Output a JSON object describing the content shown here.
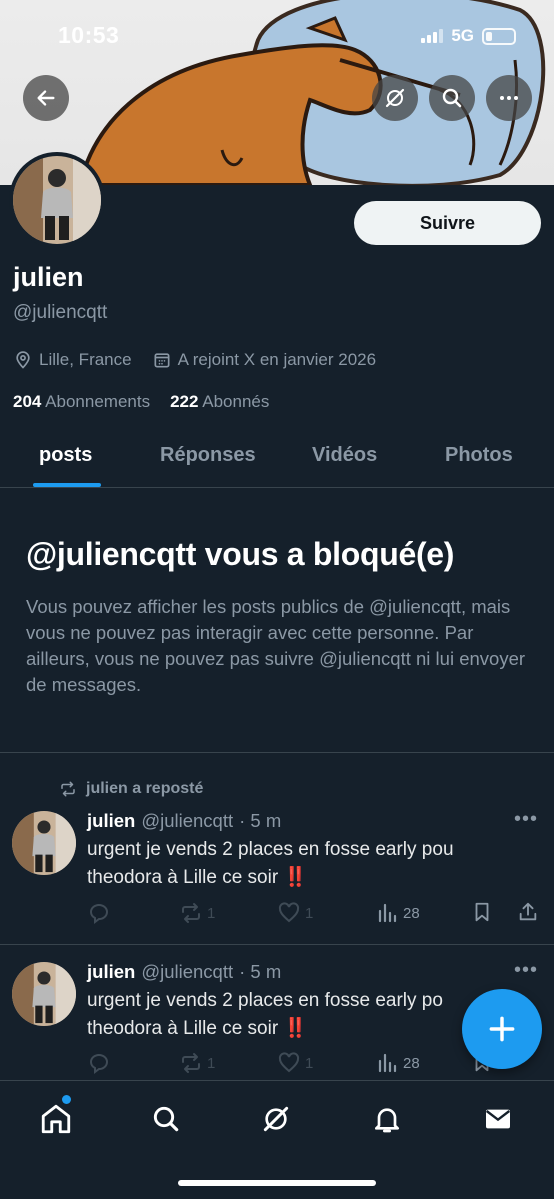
{
  "status_bar": {
    "time": "10:53",
    "network": "5G"
  },
  "header_buttons": [
    "back-icon",
    "grok-icon",
    "search-icon",
    "more-icon"
  ],
  "profile": {
    "display_name": "julien",
    "handle": "@juliencqtt",
    "follow_label": "Suivre",
    "location": "Lille, France",
    "joined": "A rejoint X en janvier 2026",
    "following_count": "204",
    "following_label": "Abonnements",
    "followers_count": "222",
    "followers_label": "Abonnés"
  },
  "tabs": [
    {
      "label": "posts",
      "active": true
    },
    {
      "label": "Réponses",
      "active": false
    },
    {
      "label": "Vidéos",
      "active": false
    },
    {
      "label": "Photos",
      "active": false
    }
  ],
  "blocked": {
    "title": "@juliencqtt vous a bloqué(e)",
    "description": "Vous pouvez afficher les posts publics de @juliencqtt, mais vous ne pouvez pas interagir avec cette personne. Par ailleurs, vous ne pouvez pas suivre @juliencqtt ni lui envoyer de messages."
  },
  "posts": [
    {
      "repost_label": "julien a reposté",
      "name": "julien",
      "handle": "@juliencqtt",
      "time": "· 5 m",
      "line1": "urgent je vends 2 places en fosse early pou",
      "line2": "theodora à Lille ce soir",
      "emoji": "‼️",
      "replies": "",
      "reposts": "1",
      "likes": "1",
      "views": "28"
    },
    {
      "name": "julien",
      "handle": "@juliencqtt",
      "time": "· 5 m",
      "line1": "urgent je vends 2 places en fosse early po",
      "line2": "theodora à Lille ce soir",
      "emoji": "‼️",
      "replies": "",
      "reposts": "1",
      "likes": "1",
      "views": "28"
    }
  ],
  "bottom_nav": [
    "home-icon",
    "search-icon",
    "grok-icon",
    "notifications-icon",
    "messages-icon"
  ],
  "colors": {
    "background": "#15202b",
    "accent": "#1d9bf0",
    "secondary_text": "#8b98a5",
    "divider": "#38444d",
    "emoji_red": "#f4212e"
  }
}
